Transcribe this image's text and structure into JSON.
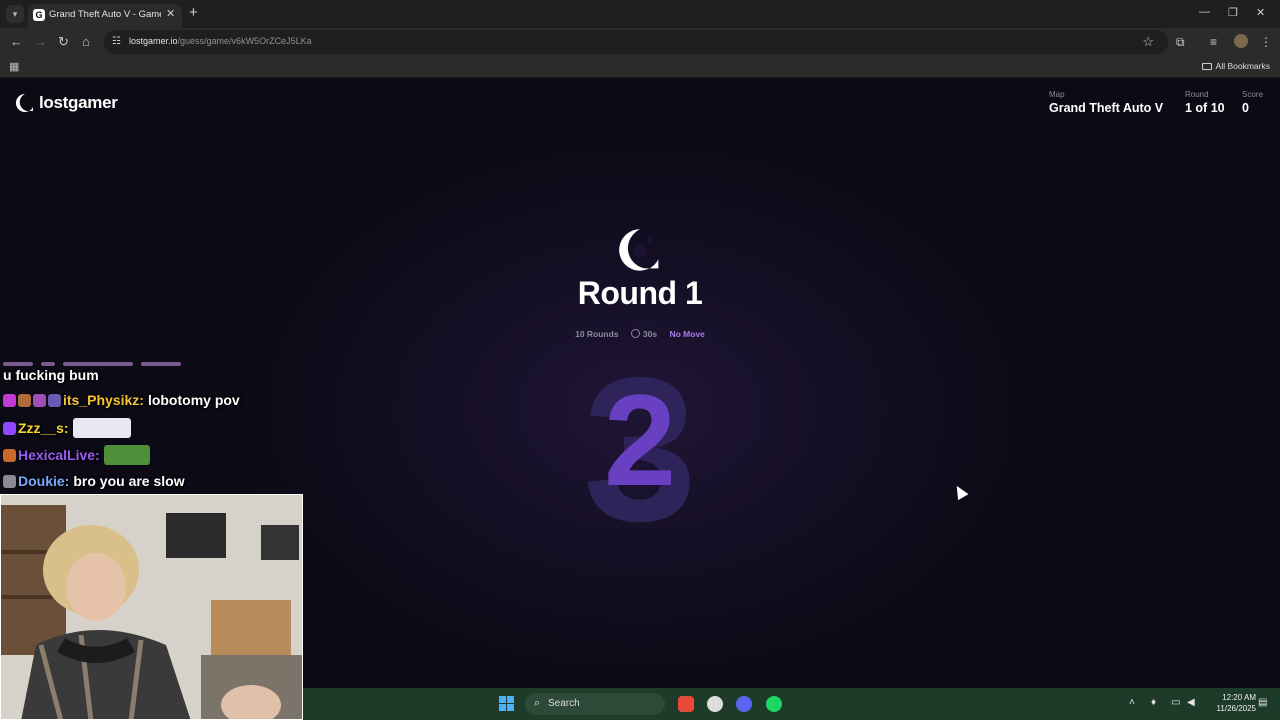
{
  "browser": {
    "tab_title": "Grand Theft Auto V - Game - G",
    "url_host": "lostgamer.io",
    "url_path": "/guess/game/v6kW5OrZCeJ5LKa",
    "bookmarks_label": "All Bookmarks"
  },
  "header": {
    "logo_text": "lostgamer",
    "map_label": "Map",
    "map_value": "Grand Theft Auto V",
    "round_label": "Round",
    "round_value": "1 of 10",
    "score_label": "Score",
    "score_value": "0"
  },
  "main": {
    "title": "Round 1",
    "chips": {
      "rounds": "10 Rounds",
      "time": "30s",
      "mode": "No Move"
    },
    "countdown_previous": "3",
    "countdown_current": "2",
    "colors": {
      "accent": "#a97ce6",
      "countdown": "#6a40c2"
    }
  },
  "chat": {
    "messages": [
      {
        "user": "",
        "text": "u fucking bum"
      },
      {
        "user": "its_Physikz:",
        "text": "lobotomy pov",
        "color": "#f5c531"
      },
      {
        "user": "Zzz__s:",
        "text": "",
        "color": "#f5d531"
      },
      {
        "user": "HexicalLive:",
        "text": "",
        "color": "#9a5cf0"
      },
      {
        "user": "Doukie:",
        "text": "bro you are slow",
        "color": "#7aa8ff"
      }
    ]
  },
  "taskbar": {
    "search_label": "Search",
    "time": "12:20 AM",
    "date": "11/26/2025"
  }
}
